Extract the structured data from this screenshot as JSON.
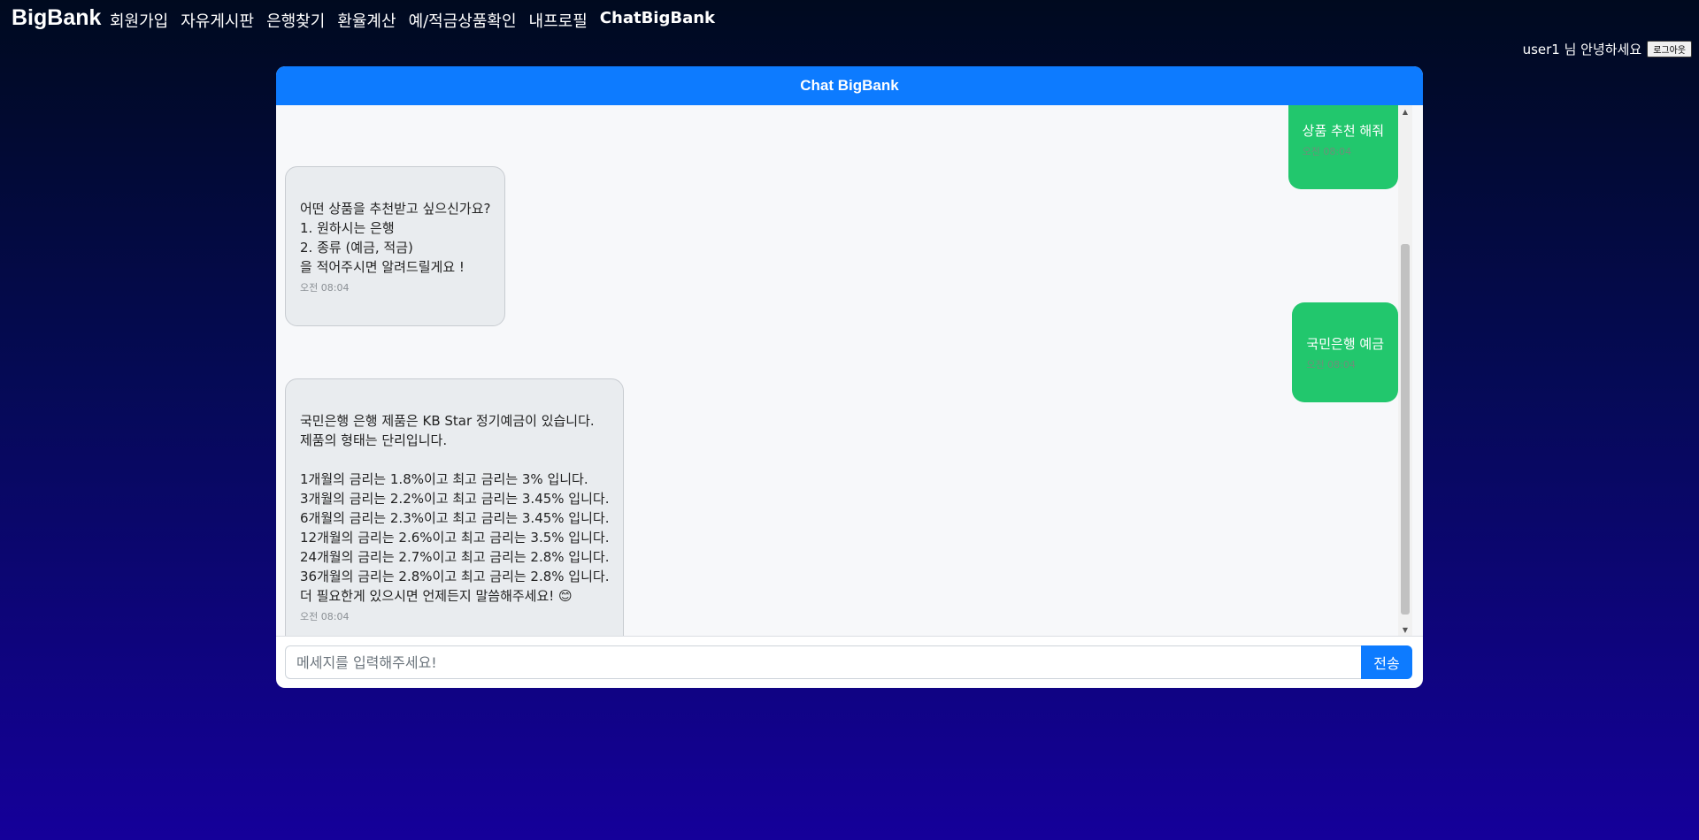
{
  "nav": {
    "brand": "BigBank",
    "links": [
      {
        "label": "회원가입"
      },
      {
        "label": "자유게시판"
      },
      {
        "label": "은행찾기"
      },
      {
        "label": "환율계산"
      },
      {
        "label": "예/적금상품확인"
      },
      {
        "label": "내프로필"
      },
      {
        "label": "ChatBigBank"
      }
    ],
    "greeting": "user1 님 안녕하세요",
    "logout_label": "로그아웃"
  },
  "chat": {
    "title": "Chat BigBank",
    "messages": [
      {
        "sender": "user",
        "text": "상품 추천 해줘",
        "time": "오전 08:04"
      },
      {
        "sender": "bot",
        "text": "어떤 상품을 추천받고 싶으신가요?\n1. 원하시는 은행\n2. 종류 (예금, 적금)\n을 적어주시면 알려드릴게요 !",
        "time": "오전 08:04"
      },
      {
        "sender": "user",
        "text": "국민은행 예금",
        "time": "오전 08:04"
      },
      {
        "sender": "bot",
        "text": "국민은행 은행 제품은 KB Star 정기예금이 있습니다.\n제품의 형태는 단리입니다.\n\n1개월의 금리는 1.8%이고 최고 금리는 3% 입니다.\n3개월의 금리는 2.2%이고 최고 금리는 3.45% 입니다.\n6개월의 금리는 2.3%이고 최고 금리는 3.45% 입니다.\n12개월의 금리는 2.6%이고 최고 금리는 3.5% 입니다.\n24개월의 금리는 2.7%이고 최고 금리는 2.8% 입니다.\n36개월의 금리는 2.8%이고 최고 금리는 2.8% 입니다.\n더 필요한게 있으시면 언제든지 말씀해주세요! 😊",
        "time": "오전 08:04"
      }
    ],
    "input_placeholder": "메세지를 입력해주세요!",
    "input_value": "",
    "send_label": "전송"
  }
}
